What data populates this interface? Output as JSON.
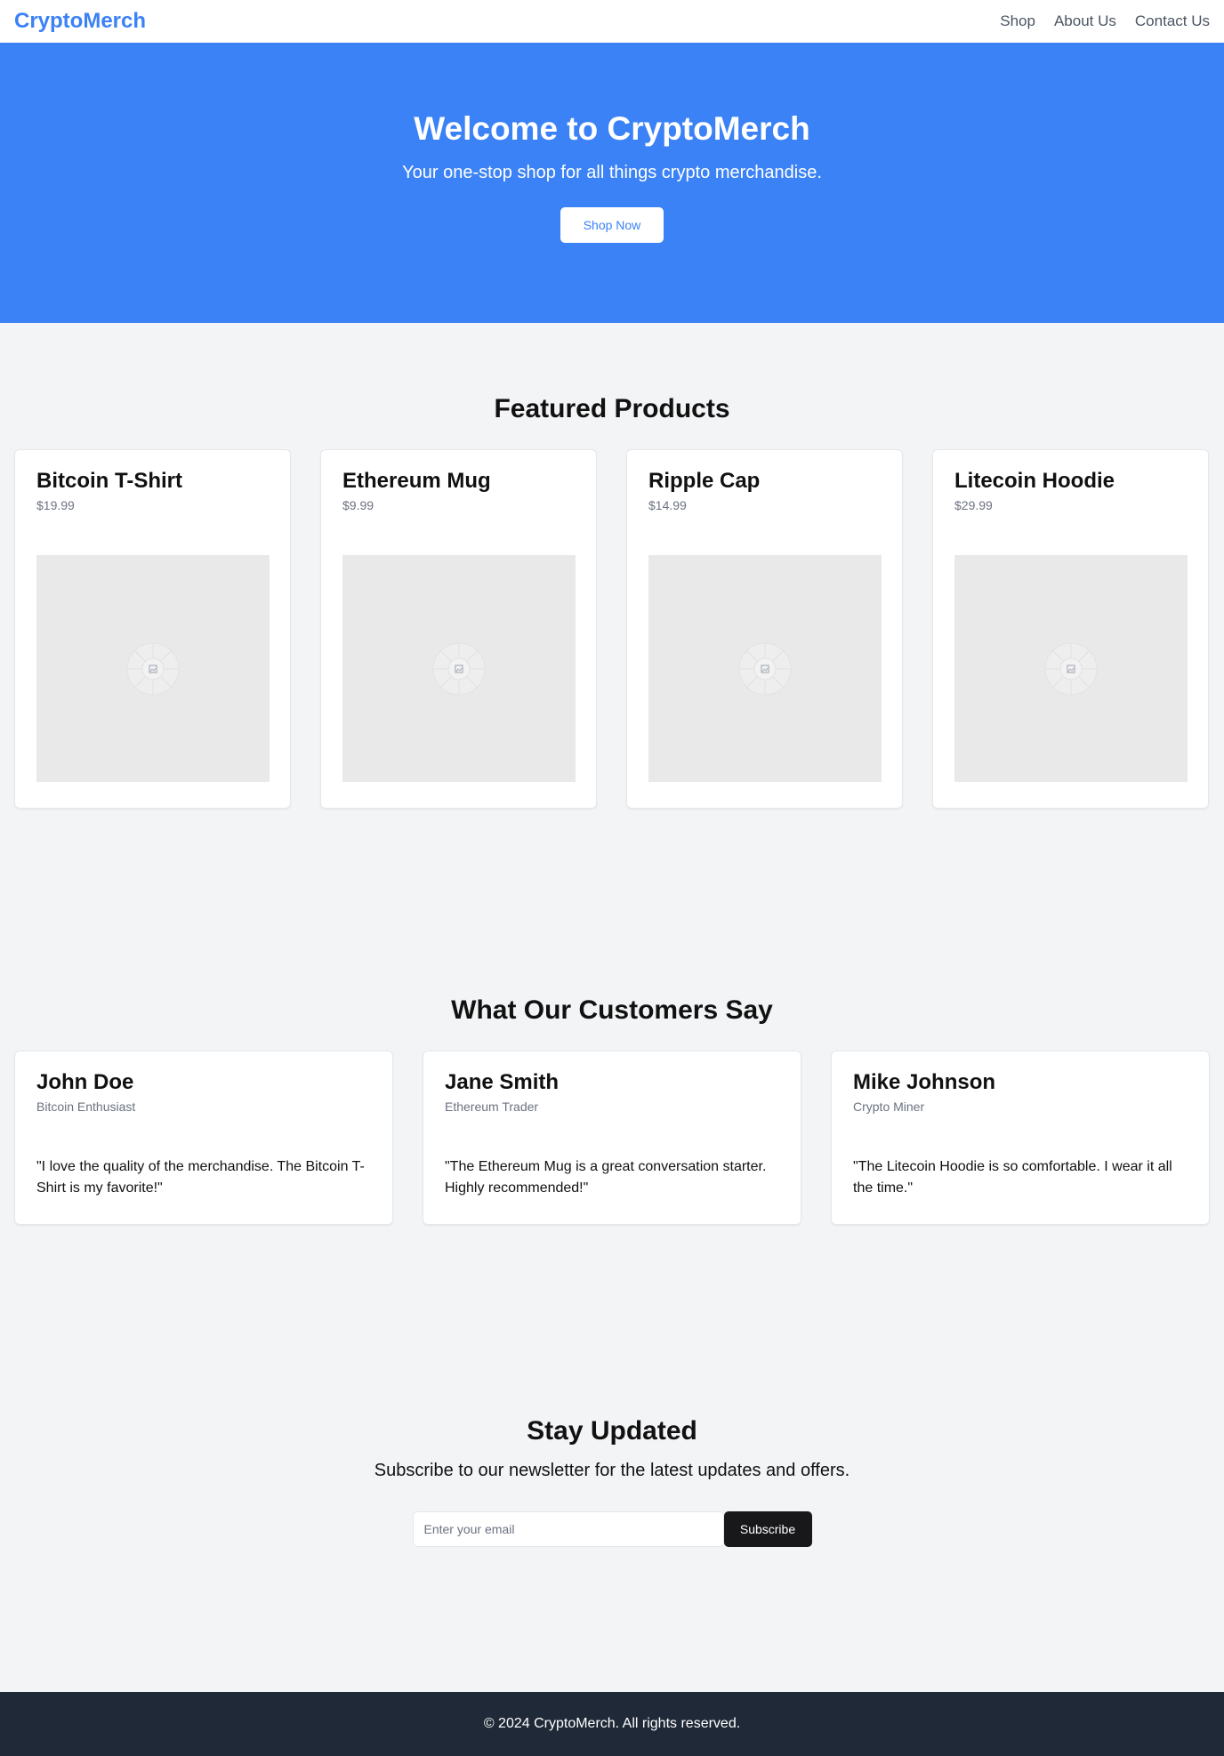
{
  "header": {
    "logo": "CryptoMerch",
    "nav": [
      "Shop",
      "About Us",
      "Contact Us"
    ]
  },
  "hero": {
    "title": "Welcome to CryptoMerch",
    "subtitle": "Your one-stop shop for all things crypto merchandise.",
    "cta": "Shop Now"
  },
  "products": {
    "title": "Featured Products",
    "items": [
      {
        "name": "Bitcoin T-Shirt",
        "price": "$19.99",
        "image_icon": "image-placeholder-icon"
      },
      {
        "name": "Ethereum Mug",
        "price": "$9.99",
        "image_icon": "image-placeholder-icon"
      },
      {
        "name": "Ripple Cap",
        "price": "$14.99",
        "image_icon": "image-placeholder-icon"
      },
      {
        "name": "Litecoin Hoodie",
        "price": "$29.99",
        "image_icon": "image-placeholder-icon"
      }
    ]
  },
  "testimonials": {
    "title": "What Our Customers Say",
    "items": [
      {
        "name": "John Doe",
        "role": "Bitcoin Enthusiast",
        "quote": "\"I love the quality of the merchandise. The Bitcoin T-Shirt is my favorite!\""
      },
      {
        "name": "Jane Smith",
        "role": "Ethereum Trader",
        "quote": "\"The Ethereum Mug is a great conversation starter. Highly recommended!\""
      },
      {
        "name": "Mike Johnson",
        "role": "Crypto Miner",
        "quote": "\"The Litecoin Hoodie is so comfortable. I wear it all the time.\""
      }
    ]
  },
  "newsletter": {
    "title": "Stay Updated",
    "text": "Subscribe to our newsletter for the latest updates and offers.",
    "email_placeholder": "Enter your email",
    "email_value": "",
    "button": "Subscribe"
  },
  "footer": {
    "text": "© 2024 CryptoMerch. All rights reserved."
  },
  "colors": {
    "primary": "#3b82f6",
    "background": "#f3f4f6",
    "footer": "#1f2937",
    "button_dark": "#18181b"
  }
}
